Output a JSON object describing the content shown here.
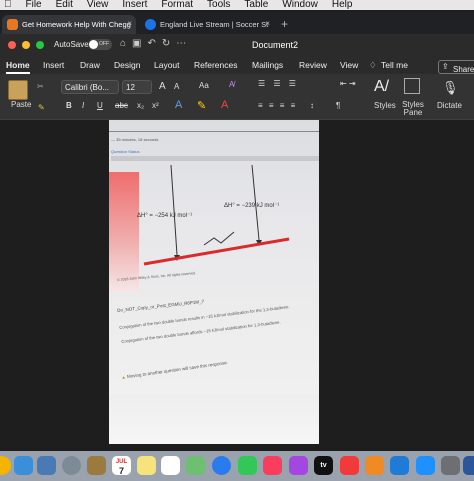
{
  "menubar": [
    "File",
    "Edit",
    "View",
    "Insert",
    "Format",
    "Tools",
    "Table",
    "Window",
    "Help"
  ],
  "browser_tabs": [
    {
      "title": "Get Homework Help With Chegg",
      "close": "×"
    },
    {
      "title": "England Live Stream | Soccer St",
      "close": "×"
    }
  ],
  "new_tab": "+",
  "titlebar": {
    "autosave": "AutoSave",
    "toggle": "OFF",
    "doc_title": "Document2"
  },
  "ribbon_tabs": [
    "Home",
    "Insert",
    "Draw",
    "Design",
    "Layout",
    "References",
    "Mailings",
    "Review",
    "View"
  ],
  "tell_me": "Tell me",
  "share": "Share",
  "ribbon": {
    "paste": "Paste",
    "font_name": "Calibri (Bo...",
    "font_size": "12",
    "grow": "A",
    "shrink": "A",
    "case": "Aa",
    "bold": "B",
    "italic": "I",
    "underline": "U",
    "strike": "abc",
    "subscript": "x₂",
    "superscript": "x²",
    "styles": "Styles",
    "styles_pane": "Styles Pane",
    "dictate": "Dictate",
    "pilcrow": "¶"
  },
  "photo": {
    "timer": "— 35 minutes, 18 seconds",
    "status": "Question Status",
    "dh1": "ΔH° = −254 kJ mol⁻¹",
    "dh2": "ΔH° = −239 kJ mol⁻¹",
    "copyright": "© 2018 John Wiley & Sons, Inc. All rights reserved.",
    "dnc": "Do_NOT_Copy_or_Post_EGMU_R6P1M_7",
    "option1": "Conjugation of the two double bonds results in ~15 kJ/mol stabilization for the 1,3-butadiene.",
    "option2": "Conjugation of the two double bonds affords ~15 kJ/mol stabilization for 1,3-butadiene.",
    "warning": "Moving to another question will save this response."
  },
  "dock": {
    "calendar_month": "JUL",
    "calendar_day": "7",
    "appletv": "tv"
  },
  "colors": {
    "word_blue": "#2b579a",
    "chegg_orange": "#e87722",
    "red_line": "#d92b2b"
  }
}
